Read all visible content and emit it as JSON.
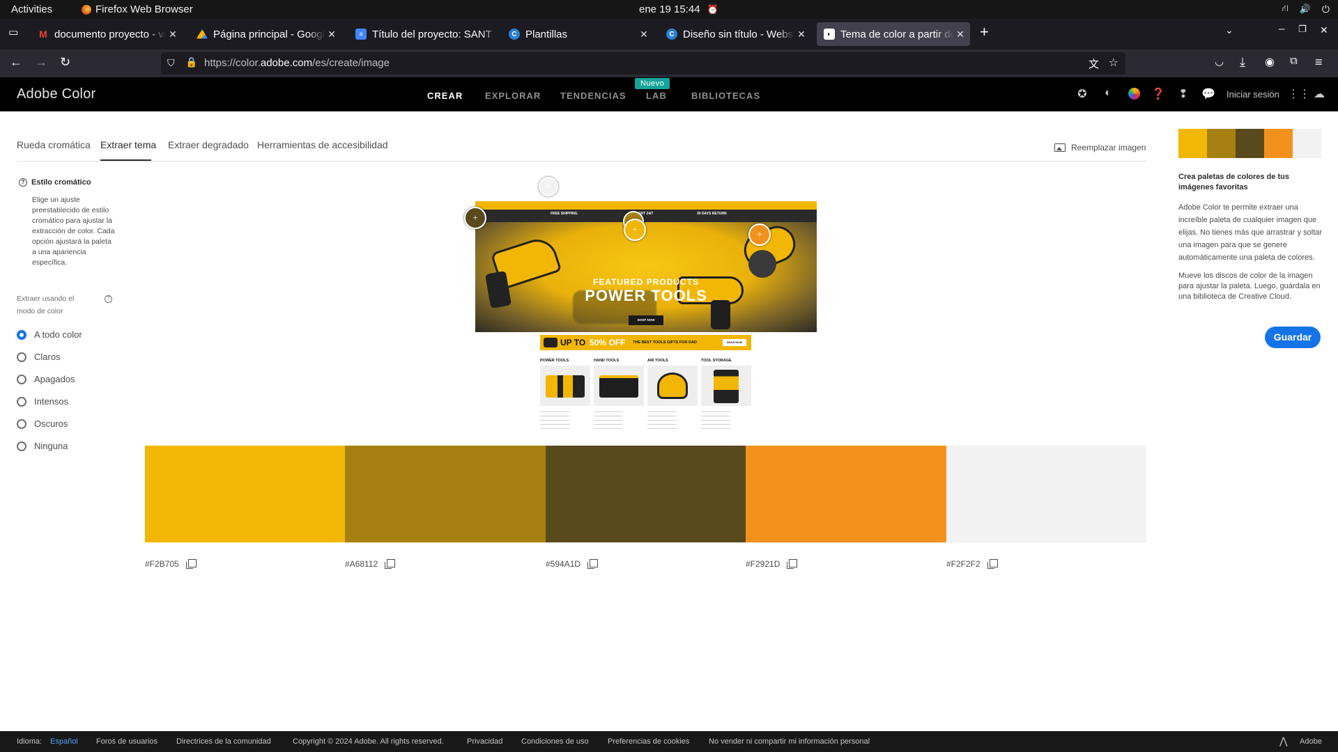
{
  "os_bar": {
    "activities": "Activities",
    "app_name": "Firefox Web Browser",
    "datetime": "ene 19  15:44"
  },
  "browser": {
    "tabs": [
      {
        "label": "documento proyecto - vic",
        "favicon": "gmail-icon"
      },
      {
        "label": "Página principal - Google",
        "favicon": "google-drive-icon"
      },
      {
        "label": "Título del proyecto: SANT",
        "favicon": "google-docs-icon"
      },
      {
        "label": "Plantillas",
        "favicon": "canva-icon"
      },
      {
        "label": "Diseño sin título - Website",
        "favicon": "canva-icon"
      },
      {
        "label": "Tema de color a partir de",
        "favicon": "adobe-color-icon",
        "active": true
      }
    ],
    "url_prefix": "https://color.",
    "url_domain": "adobe.com",
    "url_path": "/es/create/image"
  },
  "header": {
    "brand": "Adobe Color",
    "nav": [
      {
        "label": "CREAR",
        "active": true
      },
      {
        "label": "EXPLORAR"
      },
      {
        "label": "TENDENCIAS"
      },
      {
        "label": "LAB",
        "badge": "Nuevo"
      },
      {
        "label": "BIBLIOTECAS"
      }
    ],
    "sign_in": "Iniciar sesión"
  },
  "subtabs": [
    {
      "label": "Rueda cromática"
    },
    {
      "label": "Extraer tema",
      "active": true
    },
    {
      "label": "Extraer degradado"
    },
    {
      "label": "Herramientas de accesibilidad"
    }
  ],
  "replace_image": "Reemplazar imagen",
  "left_panel": {
    "title": "Estilo cromático",
    "description": "Elige un ajuste preestablecido de estilo cromático para ajustar la extracción de color. Cada opción ajustará la paleta a una apariencia específica.",
    "mode_label": "Extraer usando el modo de color",
    "options": [
      {
        "label": "A todo color",
        "selected": true
      },
      {
        "label": "Claros"
      },
      {
        "label": "Apagados"
      },
      {
        "label": "Intensos"
      },
      {
        "label": "Oscuros"
      },
      {
        "label": "Ninguna"
      }
    ]
  },
  "image_preview": {
    "hero_kicker": "FEATURED PRODUCTS",
    "hero_title": "POWER TOOLS",
    "hero_cta": "SHOP NOW",
    "promo_prefix": "UP TO",
    "promo_highlight": "50% OFF",
    "promo_suffix": "THE BEST TOOLS GIFTS FOR DAD",
    "promo_cta": "SHOP NOW",
    "info_items": [
      "FREE SHIPPING",
      "SUPPORT 24/7",
      "30 DAYS RETURN"
    ],
    "categories": [
      "POWER TOOLS",
      "HAND TOOLS",
      "AIR TOOLS",
      "TOOL STORAGE"
    ]
  },
  "palette": [
    {
      "hex": "#F2B705",
      "label": "#F2B705"
    },
    {
      "hex": "#A68112",
      "label": "#A68112"
    },
    {
      "hex": "#594A1D",
      "label": "#594A1D"
    },
    {
      "hex": "#F2921D",
      "label": "#F2921D"
    },
    {
      "hex": "#F2F2F2",
      "label": "#F2F2F2"
    }
  ],
  "right_panel": {
    "heading": "Crea paletas de colores de tus imágenes favoritas",
    "paragraph1": "Adobe Color te permite extraer una increíble paleta de cualquier imagen que elijas. No tienes más que arrastrar y soltar una imagen para que se genere automáticamente una paleta de colores.",
    "paragraph2": "Mueve los discos de color de la imagen para ajustar la paleta. Luego, guárdala en una biblioteca de Creative Cloud.",
    "save": "Guardar"
  },
  "footer": {
    "language_label": "Idioma:",
    "language_value": "Español",
    "links": [
      "Foros de usuarios",
      "Directrices de la comunidad",
      "Copyright © 2024 Adobe. All rights reserved.",
      "Privacidad",
      "Condiciones de uso",
      "Preferencias de cookies",
      "No vender ni compartir mi información personal"
    ],
    "brand": "Adobe"
  }
}
